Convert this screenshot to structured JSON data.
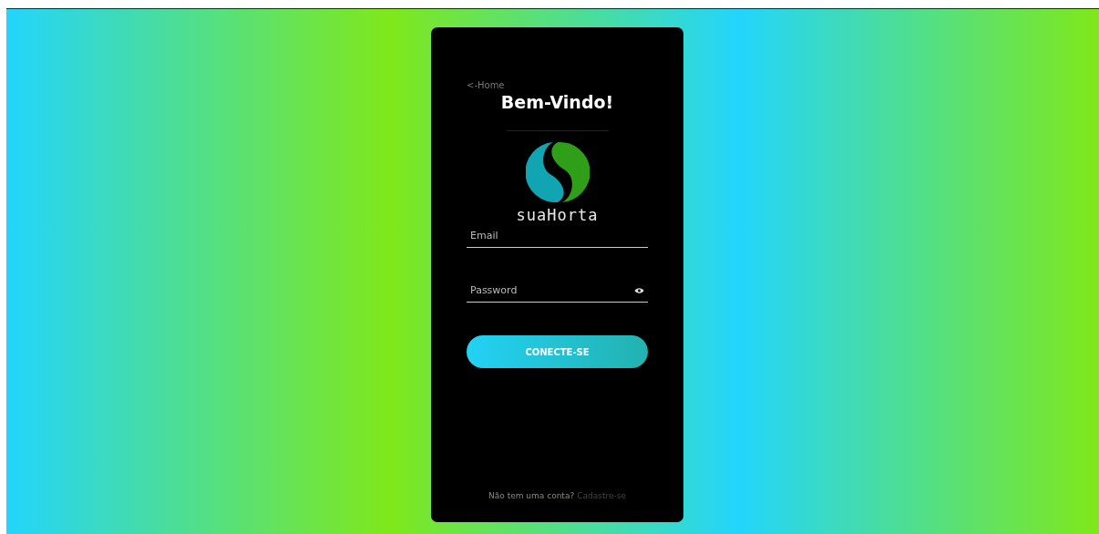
{
  "back_link": "<-Home",
  "title": "Bem-Vindo!",
  "logo": {
    "wordmark": "suaHorta"
  },
  "fields": [
    {
      "placeholder": "Email",
      "kind": "text"
    },
    {
      "placeholder": "Password",
      "kind": "password"
    }
  ],
  "submit": "CONECTE-SE",
  "footer": {
    "text": "Não tem uma conta?",
    "link": "Cadastre-se"
  }
}
